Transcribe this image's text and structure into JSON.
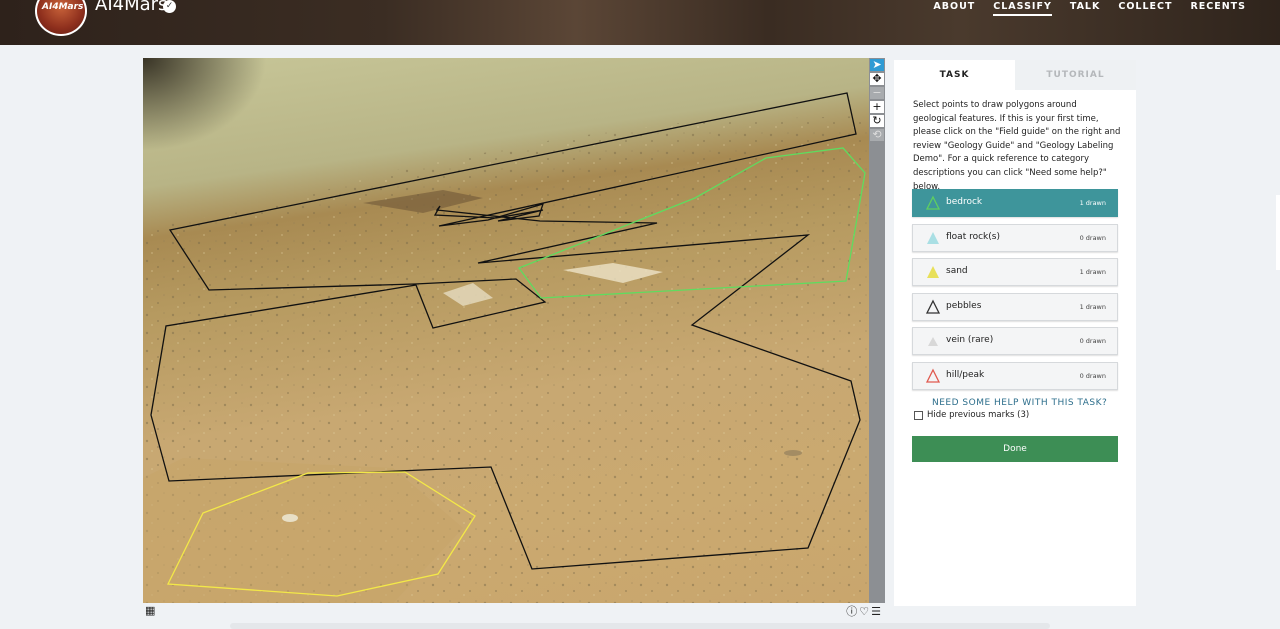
{
  "site": {
    "name": "AI4Mars",
    "logo_text": "AI4Mars"
  },
  "nav": [
    "ABOUT",
    "CLASSIFY",
    "TALK",
    "COLLECT",
    "RECENTS"
  ],
  "nav_active": "CLASSIFY",
  "panel": {
    "tabs": [
      "TASK",
      "TUTORIAL"
    ],
    "instructions": "Select points to draw polygons around geological features. If this is your first time, please click on the \"Field guide\" on the right and review \"Geology Guide\" and \"Geology Labeling Demo\". For a quick reference to category descriptions you can click \"Need some help?\" below.",
    "tools": [
      {
        "label": "bedrock",
        "count": "1 drawn",
        "color": "#5fcf5f",
        "active": true
      },
      {
        "label": "float rock(s)",
        "count": "0 drawn",
        "color": "#a9dfe4",
        "active": false
      },
      {
        "label": "sand",
        "count": "1 drawn",
        "color": "#e8e05a",
        "active": false
      },
      {
        "label": "pebbles",
        "count": "1 drawn",
        "color": "#333333",
        "active": false
      },
      {
        "label": "vein (rare)",
        "count": "0 drawn",
        "color": "#d8d8d8",
        "active": false
      },
      {
        "label": "hill/peak",
        "count": "0 drawn",
        "color": "#e05a4f",
        "active": false
      }
    ],
    "help_link": "NEED SOME HELP WITH THIS TASK?",
    "hide_marks_label": "Hide previous marks (3)",
    "done_label": "Done"
  },
  "toolbar": {
    "tools": [
      {
        "name": "pointer-tool",
        "glyph": "➤",
        "state": "active"
      },
      {
        "name": "pan-tool",
        "glyph": "✥",
        "state": "normal"
      },
      {
        "name": "zoom-out-tool",
        "glyph": "−",
        "state": "disabled"
      },
      {
        "name": "zoom-in-tool",
        "glyph": "+",
        "state": "normal"
      },
      {
        "name": "rotate-tool",
        "glyph": "↻",
        "state": "normal"
      },
      {
        "name": "reset-tool",
        "glyph": "⟲",
        "state": "disabled"
      }
    ]
  },
  "subject_meta": {
    "icons": [
      "info-icon",
      "heart-icon",
      "list-icon"
    ],
    "grid_icon": "grid-icon"
  },
  "colors": {
    "bedrock": "#5fcf5f",
    "sand": "#e8e05a",
    "pebbles": "#111111",
    "done": "#3d8e55",
    "active_tool": "#3e959b"
  }
}
